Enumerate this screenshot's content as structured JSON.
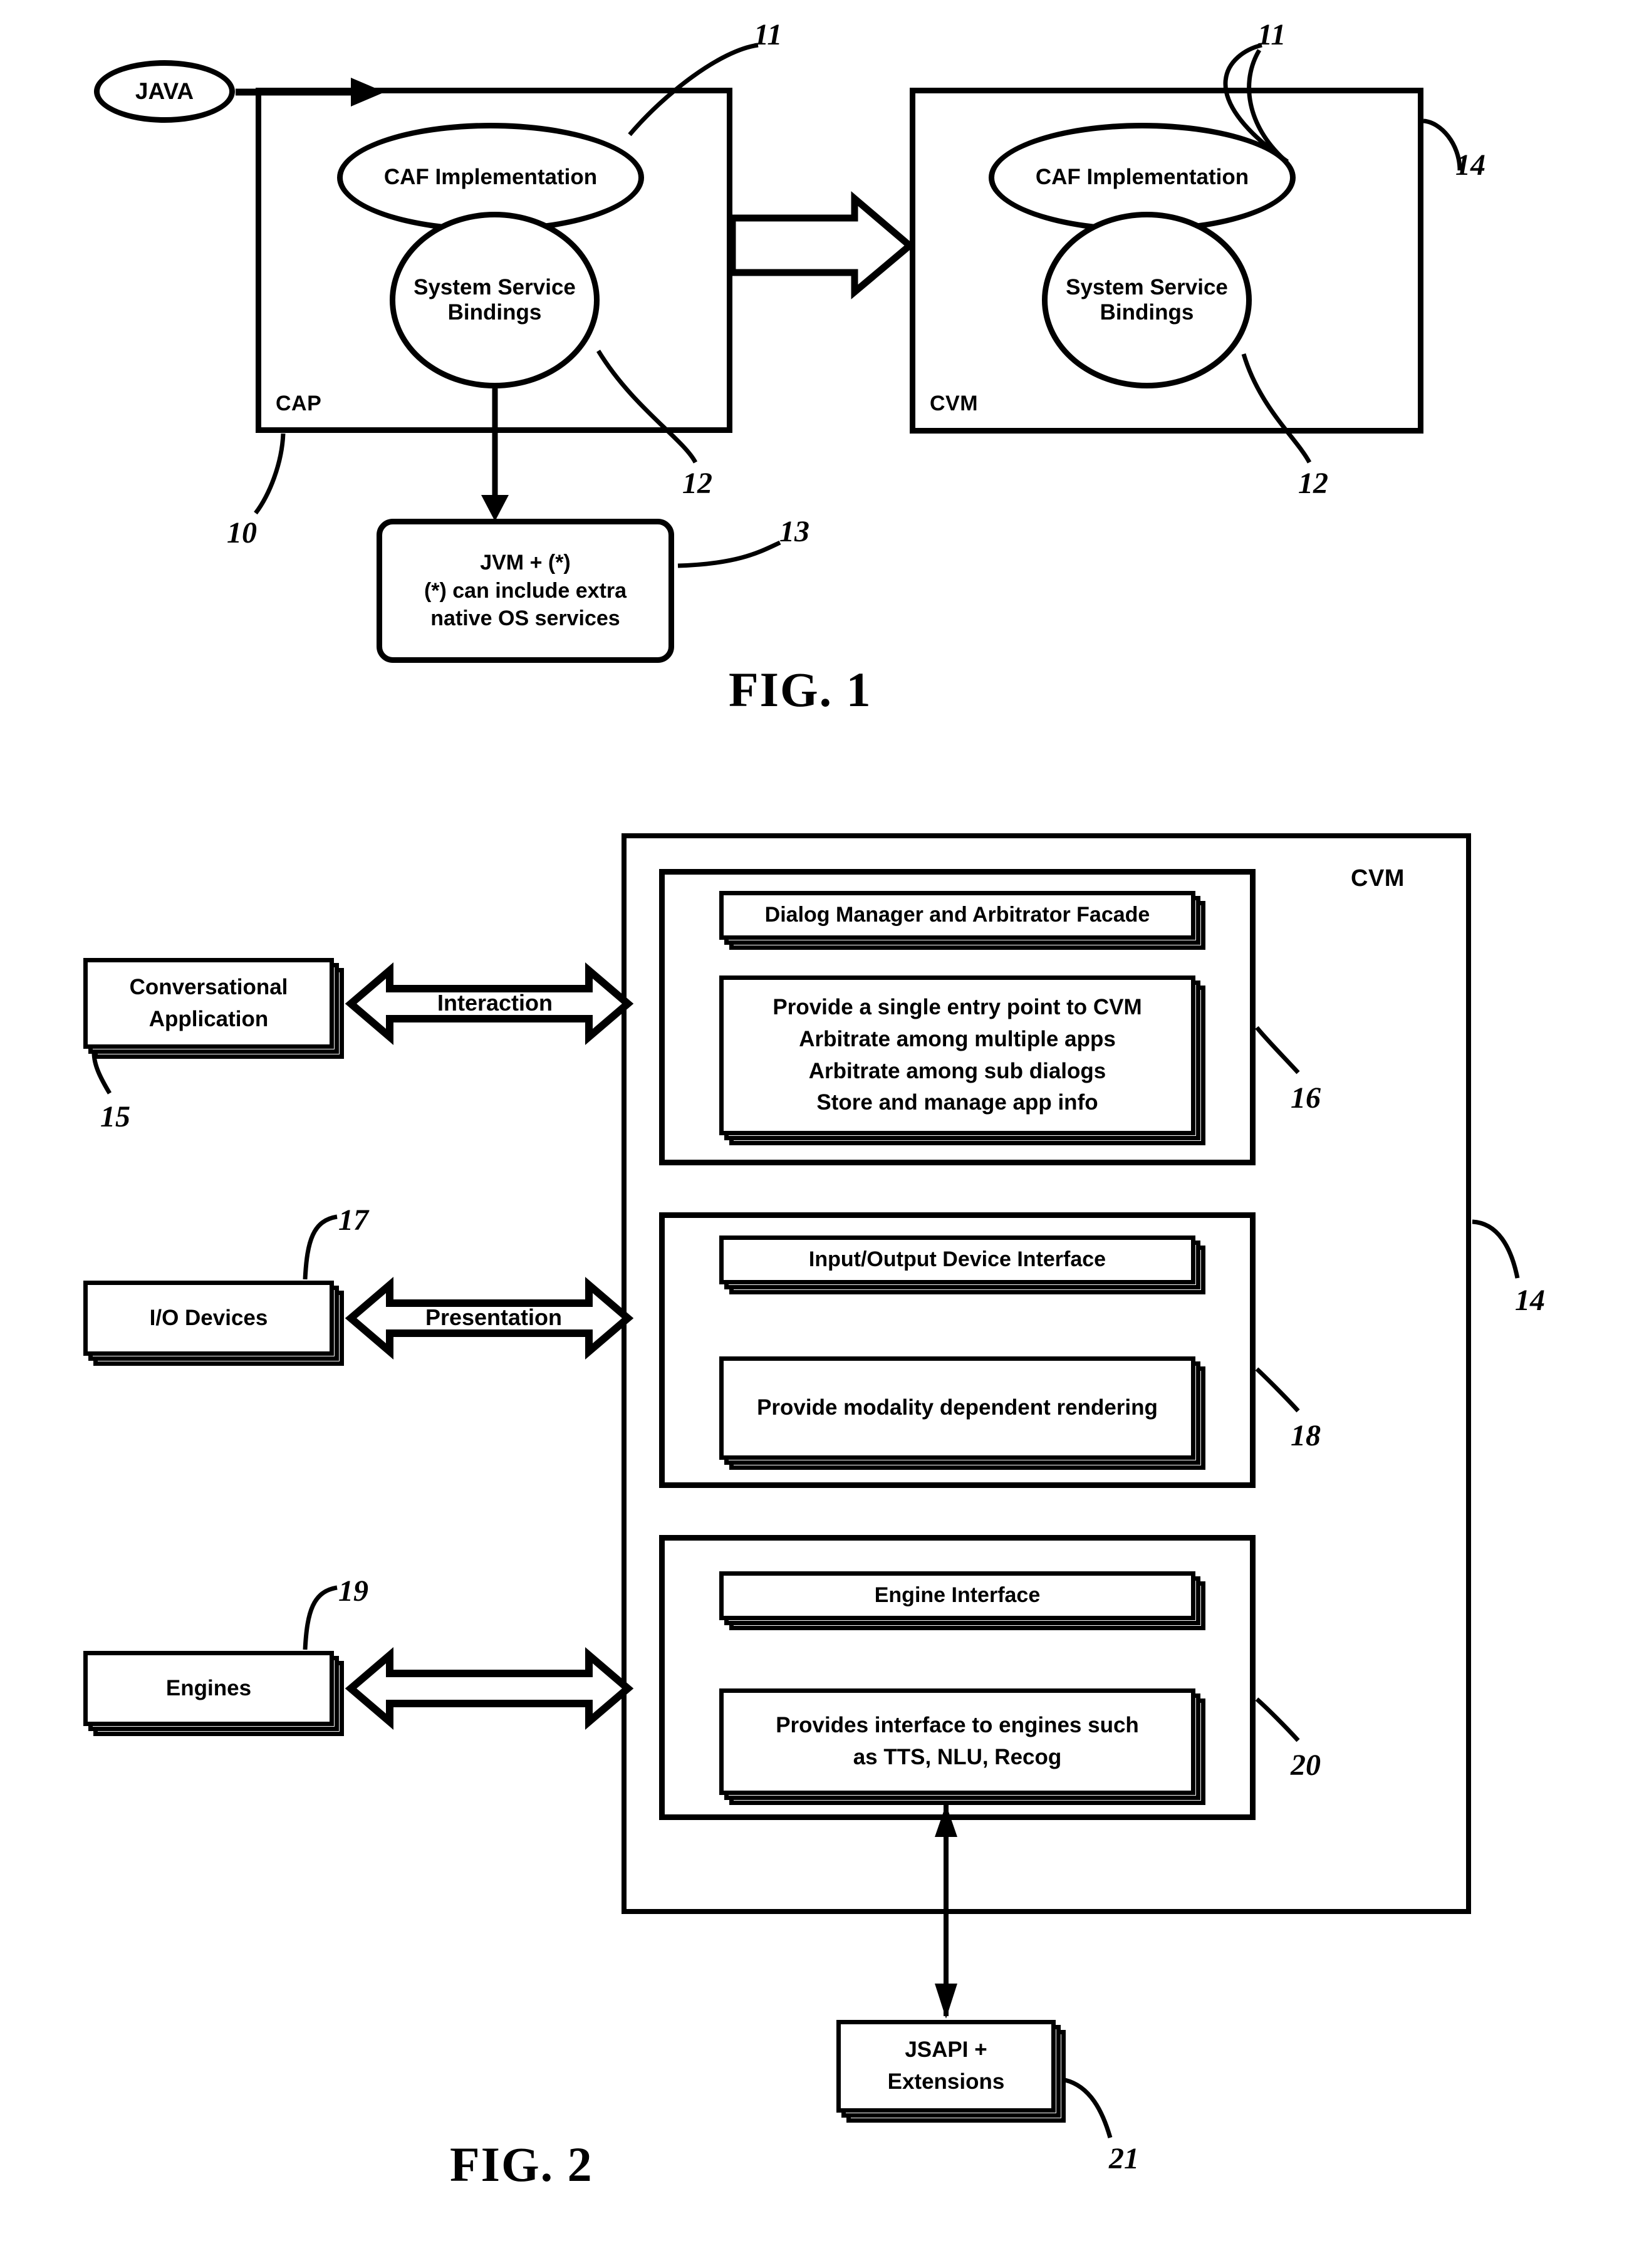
{
  "figure1": {
    "caption": "FIG. 1",
    "java_node": "JAVA",
    "cap_box": {
      "corner_label": "CAP",
      "ref": "10",
      "caf": "CAF Implementation",
      "caf_ref": "11",
      "ssb_line1": "System Service",
      "ssb_line2": "Bindings",
      "ssb_ref": "12"
    },
    "cvm_box": {
      "corner_label": "CVM",
      "ref": "14",
      "caf": "CAF Implementation",
      "caf_ref": "11",
      "ssb_line1": "System Service",
      "ssb_line2": "Bindings",
      "ssb_ref": "12"
    },
    "jvm_box": {
      "line1": "JVM + (*)",
      "line2": "(*) can include extra",
      "line3": "native OS services",
      "ref": "13"
    }
  },
  "figure2": {
    "caption": "FIG. 2",
    "cvm_corner_label": "CVM",
    "cvm_ref": "14",
    "left_nodes": [
      {
        "line1": "Conversational",
        "line2": "Application",
        "ref": "15"
      },
      {
        "line1": "I/O Devices",
        "line2": "",
        "ref": "17"
      },
      {
        "line1": "Engines",
        "line2": "",
        "ref": "19"
      }
    ],
    "arrow_labels": [
      "Interaction",
      "Presentation",
      ""
    ],
    "groups": [
      {
        "ref": "16",
        "header": "Dialog Manager and Arbitrator Facade",
        "body": [
          "Provide a single entry point to CVM",
          "Arbitrate among multiple apps",
          "Arbitrate among sub dialogs",
          "Store and manage app info"
        ]
      },
      {
        "ref": "18",
        "header": "Input/Output Device Interface",
        "body": [
          "Provide modality dependent rendering"
        ]
      },
      {
        "ref": "20",
        "header": "Engine Interface",
        "body": [
          "Provides interface to engines such",
          "as TTS, NLU, Recog"
        ]
      }
    ],
    "jsapi_box": {
      "line1": "JSAPI +",
      "line2": "Extensions",
      "ref": "21"
    }
  }
}
